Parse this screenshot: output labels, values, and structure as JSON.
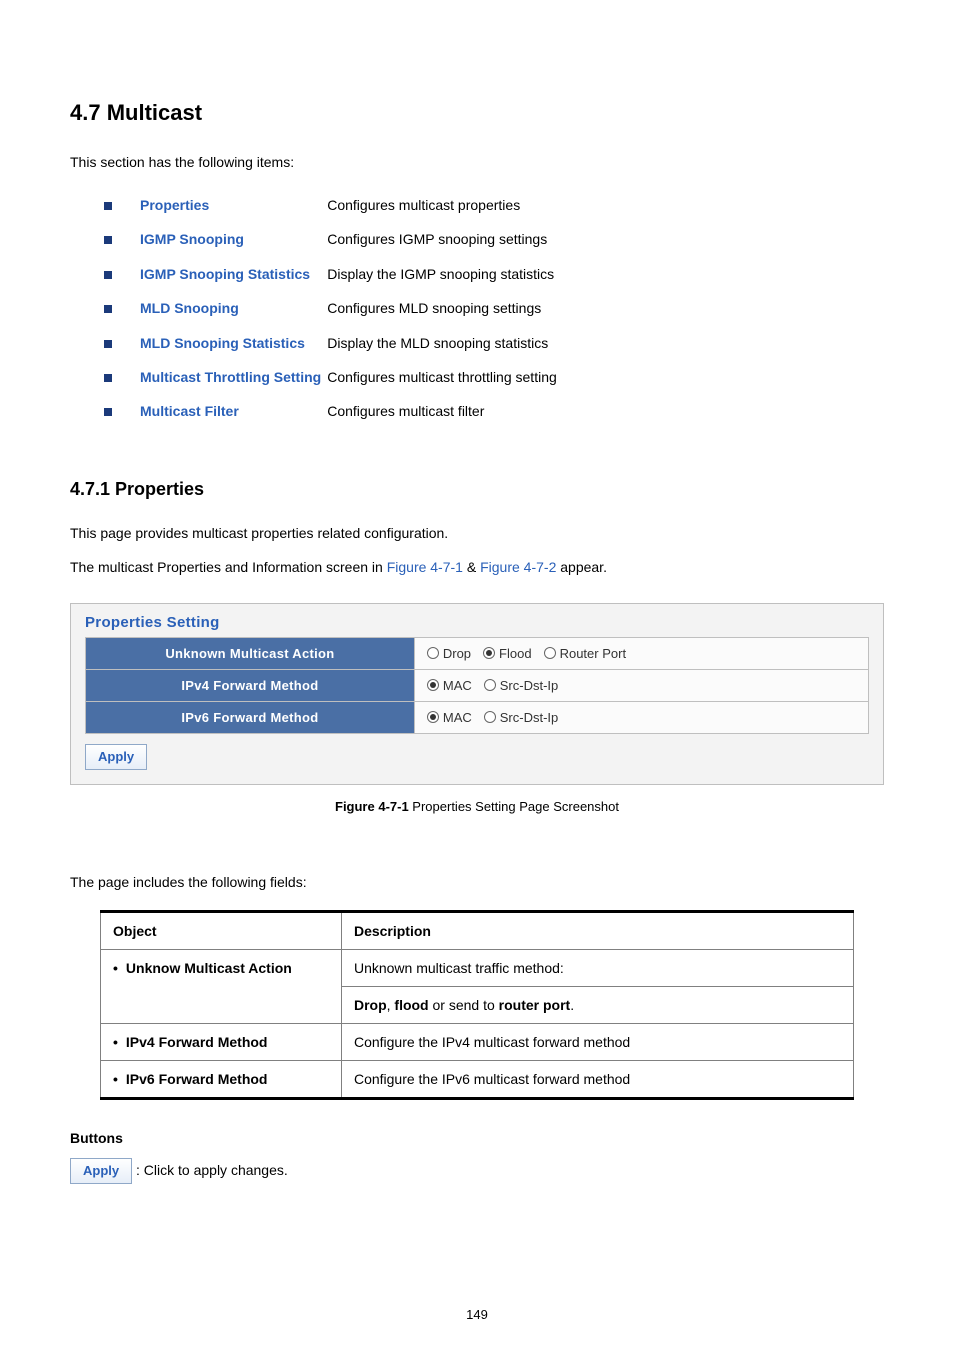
{
  "section": {
    "title": "4.7 Multicast",
    "intro": "This section has the following items:"
  },
  "items": [
    {
      "label": "Properties",
      "desc": "Configures multicast properties"
    },
    {
      "label": "IGMP Snooping",
      "desc": "Configures IGMP snooping settings"
    },
    {
      "label": "IGMP Snooping Statistics",
      "desc": "Display the IGMP snooping statistics"
    },
    {
      "label": "MLD Snooping",
      "desc": "Configures MLD snooping settings"
    },
    {
      "label": "MLD Snooping Statistics",
      "desc": "Display the MLD snooping statistics"
    },
    {
      "label": "Multicast Throttling Setting",
      "desc": "Configures multicast throttling setting"
    },
    {
      "label": "Multicast Filter",
      "desc": "Configures multicast filter"
    }
  ],
  "sub": {
    "title": "4.7.1 Properties",
    "p1": "This page provides multicast properties related configuration.",
    "p2_prefix": "The multicast Properties and Information screen in ",
    "p2_ref1": "Figure 4-7-1",
    "p2_amp": " & ",
    "p2_ref2": "Figure 4-7-2",
    "p2_suffix": " appear."
  },
  "panel": {
    "title": "Properties Setting",
    "rows": [
      {
        "label": "Unknown Multicast Action",
        "options": [
          {
            "text": "Drop",
            "checked": false
          },
          {
            "text": "Flood",
            "checked": true
          },
          {
            "text": "Router Port",
            "checked": false
          }
        ]
      },
      {
        "label": "IPv4 Forward Method",
        "options": [
          {
            "text": "MAC",
            "checked": true
          },
          {
            "text": "Src-Dst-Ip",
            "checked": false
          }
        ]
      },
      {
        "label": "IPv6 Forward Method",
        "options": [
          {
            "text": "MAC",
            "checked": true
          },
          {
            "text": "Src-Dst-Ip",
            "checked": false
          }
        ]
      }
    ],
    "apply_label": "Apply"
  },
  "figure": {
    "id": "Figure 4-7-1",
    "caption": " Properties Setting Page Screenshot"
  },
  "fields_intro": "The page includes the following fields:",
  "desc_table": {
    "headers": {
      "obj": "Object",
      "desc": "Description"
    },
    "rows": [
      {
        "obj": "Unknow Multicast Action",
        "desc_line1": "Unknown multicast traffic method:",
        "desc_line2_parts": [
          "Drop",
          ", ",
          "flood",
          " or send to ",
          "router port",
          "."
        ]
      },
      {
        "obj": "IPv4 Forward Method",
        "desc": "Configure the IPv4 multicast forward method"
      },
      {
        "obj": "IPv6 Forward Method",
        "desc": "Configure the IPv6 multicast forward method"
      }
    ]
  },
  "buttons": {
    "heading": "Buttons",
    "apply_label": "Apply",
    "tail": ": Click to apply changes."
  },
  "page_number": "149"
}
